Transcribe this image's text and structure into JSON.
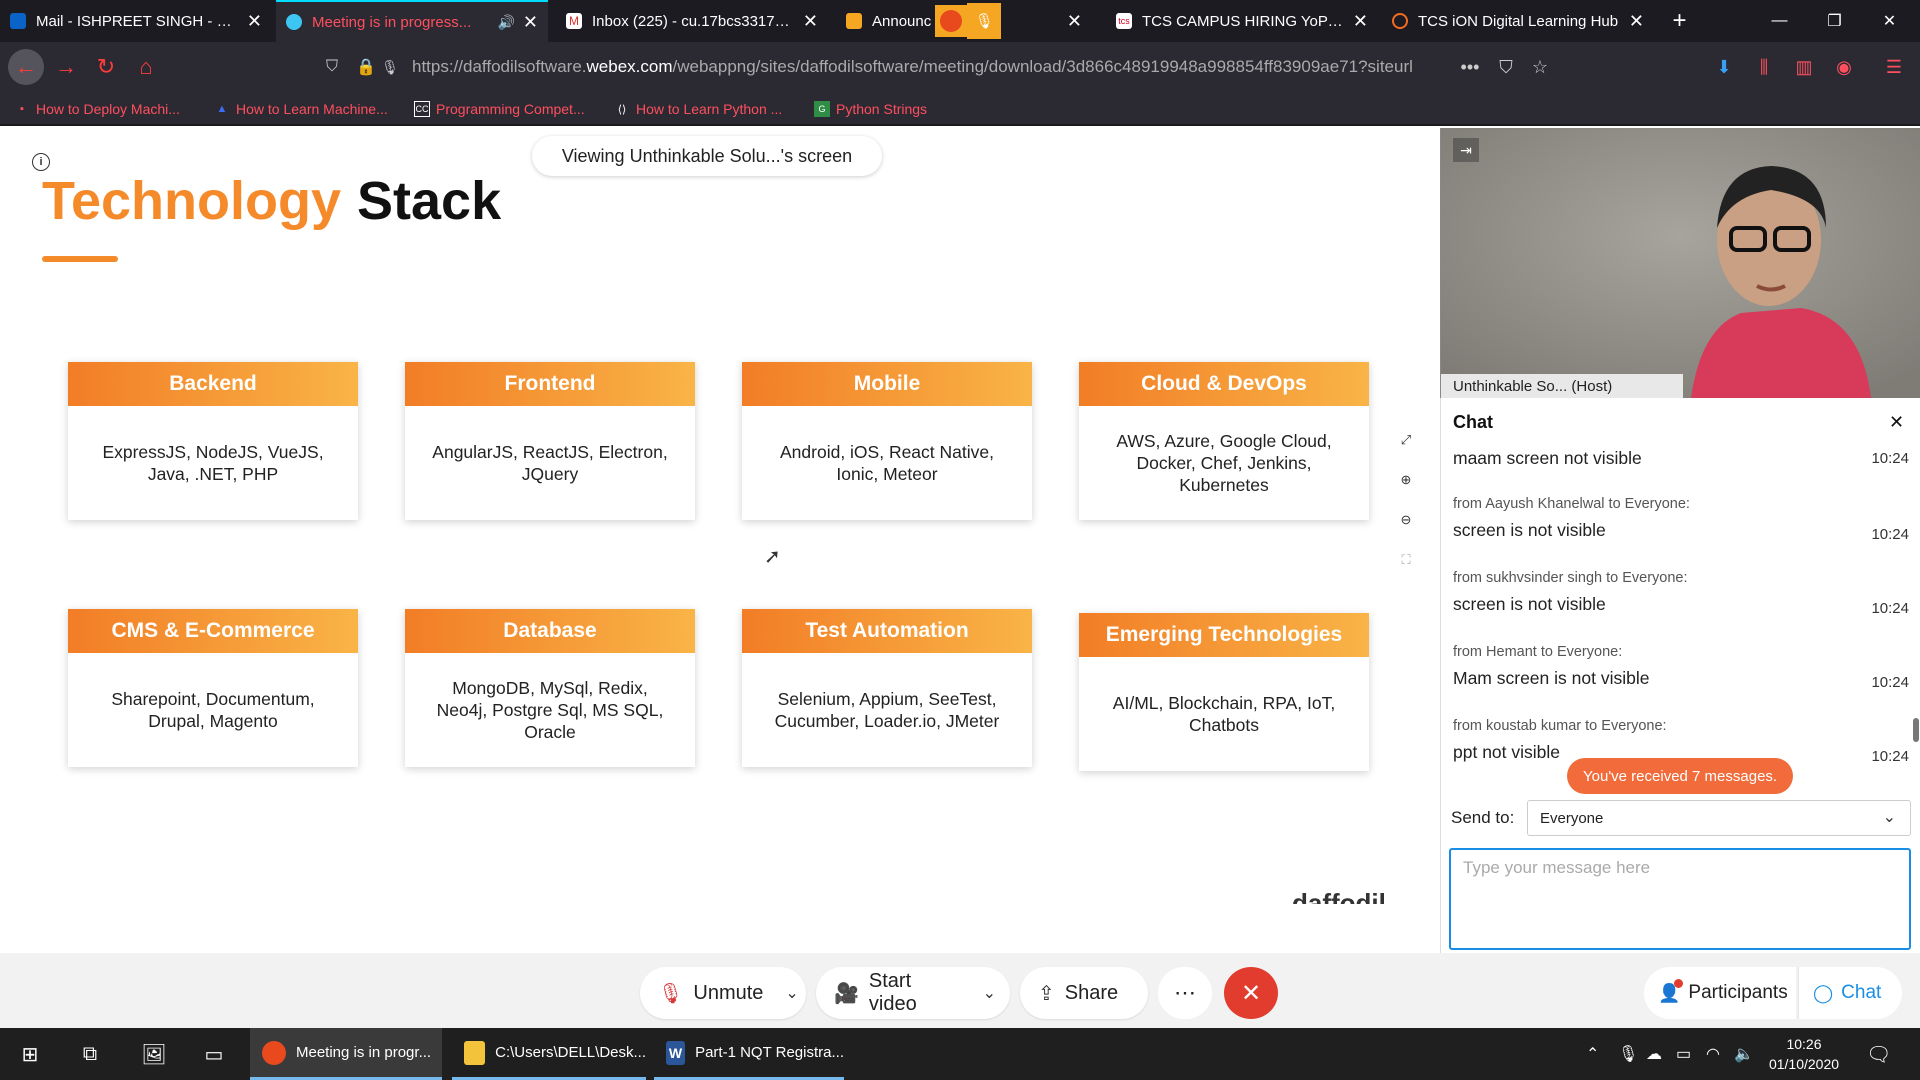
{
  "browser": {
    "tabs": [
      {
        "label": "Mail - ISHPREET SINGH - Outl",
        "icon": "outlook-icon"
      },
      {
        "label": "Meeting is in progress...",
        "icon": "webex-icon"
      },
      {
        "label": "Inbox (225) - cu.17bcs3317@g",
        "icon": "gmail-icon"
      },
      {
        "label": "Announc",
        "icon": "announcement-icon"
      },
      {
        "label": "TCS CAMPUS HIRING YoP 2021",
        "icon": "tcs-icon"
      },
      {
        "label": "TCS iON Digital Learning Hub",
        "icon": "tcs-ion-icon"
      }
    ],
    "url_prefix": "https://daffodilsoftware.",
    "url_host": "webex.com",
    "url_suffix": "/webappng/sites/daffodilsoftware/meeting/download/3d866c48919948a998854ff83909ae71?siteurl",
    "bookmarks": [
      "How to Deploy Machi...",
      "How to Learn Machine...",
      "Programming Compet...",
      "How to Learn Python ...",
      "Python Strings"
    ],
    "bookmark_badge": "CC"
  },
  "share": {
    "viewing_label": "Viewing Unthinkable Solu...'s screen",
    "slide_title_part1": "Technology",
    "slide_title_part2": "Stack",
    "cards": [
      {
        "title": "Backend",
        "body": "ExpressJS, NodeJS, VueJS,  Java, .NET, PHP"
      },
      {
        "title": "Frontend",
        "body": "AngularJS, ReactJS, Electron, JQuery"
      },
      {
        "title": "Mobile",
        "body": "Android, iOS, React Native, Ionic, Meteor"
      },
      {
        "title": "Cloud & DevOps",
        "body": "AWS, Azure, Google Cloud, Docker, Chef, Jenkins, Kubernetes"
      },
      {
        "title": "CMS & E-Commerce",
        "body": "Sharepoint, Documentum, Drupal, Magento"
      },
      {
        "title": "Database",
        "body": "MongoDB, MySql, Redix, Neo4j, Postgre Sql, MS SQL, Oracle"
      },
      {
        "title": "Test Automation",
        "body": "Selenium, Appium, SeeTest, Cucumber, Loader.io, JMeter"
      },
      {
        "title": "Emerging Technologies",
        "body": "AI/ML, Blockchain, RPA, IoT, Chatbots"
      }
    ],
    "logo_partial": "daffodil"
  },
  "video": {
    "name": "Unthinkable So...",
    "role": "(Host)"
  },
  "chat": {
    "title": "Chat",
    "messages": [
      {
        "from": "",
        "text": "maam screen not visible",
        "time": "10:24"
      },
      {
        "from": "from Aayush Khanelwal to Everyone:",
        "text": "screen is not visible",
        "time": "10:24"
      },
      {
        "from": "from sukhvsinder singh to Everyone:",
        "text": "screen is not visible",
        "time": "10:24"
      },
      {
        "from": "from Hemant to Everyone:",
        "text": "Mam screen is not visible",
        "time": "10:24"
      },
      {
        "from": "from koustab kumar to Everyone:",
        "text": "ppt not visible",
        "time": "10:24"
      }
    ],
    "toast": "You've received 7 messages.",
    "send_to_label": "Send to:",
    "send_to_value": "Everyone",
    "input_placeholder": "Type your message here"
  },
  "controls": {
    "unmute": "Unmute",
    "start_video": "Start video",
    "share": "Share",
    "participants": "Participants",
    "chat": "Chat"
  },
  "taskbar": {
    "apps": [
      {
        "label": "Meeting is in progr..."
      },
      {
        "label": "C:\\Users\\DELL\\Desk..."
      },
      {
        "label": "Part-1 NQT Registra..."
      }
    ],
    "time": "10:26",
    "date": "01/10/2020"
  },
  "colors": {
    "accent_orange": "#f58a2a",
    "webex_blue": "#1a8ee6",
    "end_red": "#e23c2f"
  }
}
